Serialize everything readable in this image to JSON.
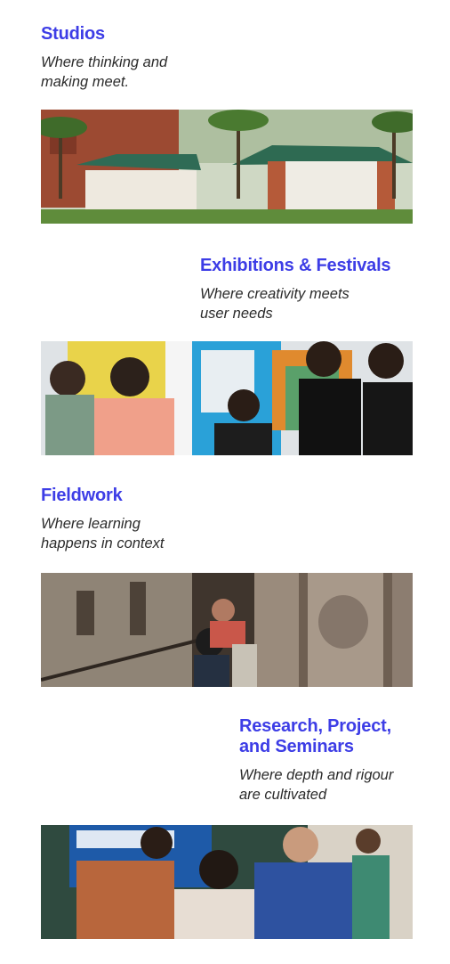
{
  "sections": [
    {
      "title": "Studios",
      "subtitle": "Where thinking and\nmaking meet.",
      "image": "photo of red-brick studio buildings with green roofs among coconut palms"
    },
    {
      "title": "Exhibitions & Festivals",
      "subtitle": "Where creativity meets\nuser needs",
      "image": "photo of students talking at an exhibition with colorful display boards"
    },
    {
      "title": "Fieldwork",
      "subtitle": "Where learning\nhappens in context",
      "image": "photo of students examining carved stone pillars in an ancient temple corridor"
    },
    {
      "title": "Research, Project,\nand Seminars",
      "subtitle": "Where depth and rigour\nare cultivated",
      "image": "photo of faculty and students working together at a table in a classroom"
    }
  ],
  "colors": {
    "accent": "#3d3de6",
    "body_text": "#2b2b2b",
    "background": "#ffffff"
  }
}
